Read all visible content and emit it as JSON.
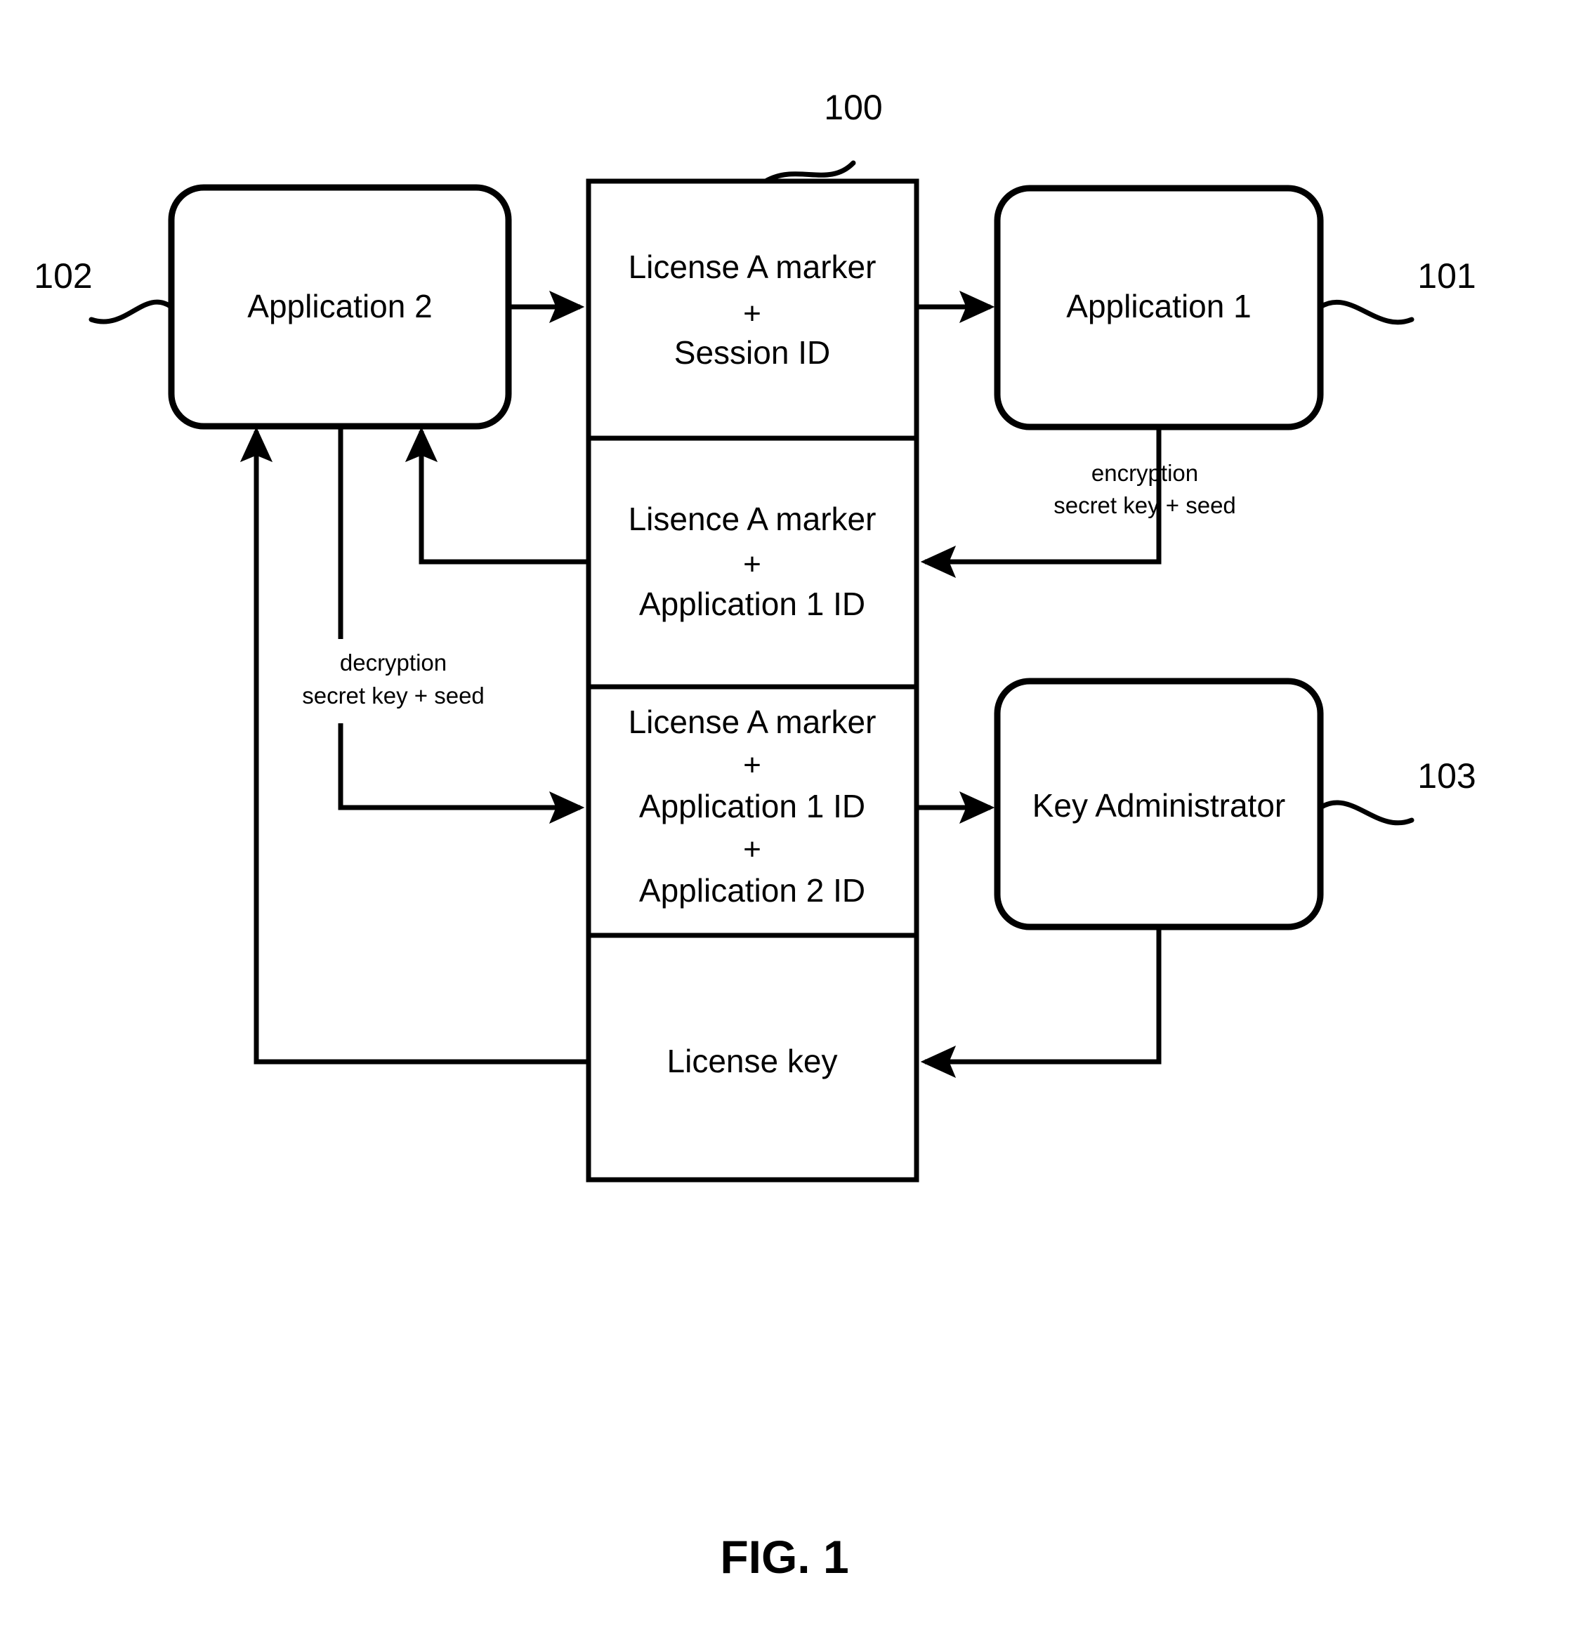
{
  "figure": {
    "caption": "FIG. 1"
  },
  "nodes": [
    {
      "id": "application-2",
      "label": "Application 2",
      "ref": "102"
    },
    {
      "id": "application-1",
      "label": "Application 1",
      "ref": "101"
    },
    {
      "id": "key-administrator",
      "label": "Key Administrator",
      "ref": "103"
    }
  ],
  "message_stack": {
    "ref": "100",
    "rows": [
      {
        "id": "row-license-a-session",
        "lines": [
          "License A marker",
          "+",
          "Session ID"
        ]
      },
      {
        "id": "row-lisence-a-app1",
        "lines": [
          "Lisence A marker",
          "+",
          "Application 1 ID"
        ]
      },
      {
        "id": "row-license-a-app1-app2",
        "lines": [
          "License A marker",
          "+",
          "Application 1 ID",
          "+",
          "Application 2 ID"
        ]
      },
      {
        "id": "row-license-key",
        "lines": [
          "License key"
        ]
      }
    ]
  },
  "annotations": [
    {
      "id": "encryption-annotation",
      "lines": [
        "encryption",
        "secret key + seed"
      ]
    },
    {
      "id": "decryption-annotation",
      "lines": [
        "decryption",
        "secret key + seed"
      ]
    }
  ],
  "colors": {
    "stroke": "#000000",
    "background": "#ffffff"
  }
}
